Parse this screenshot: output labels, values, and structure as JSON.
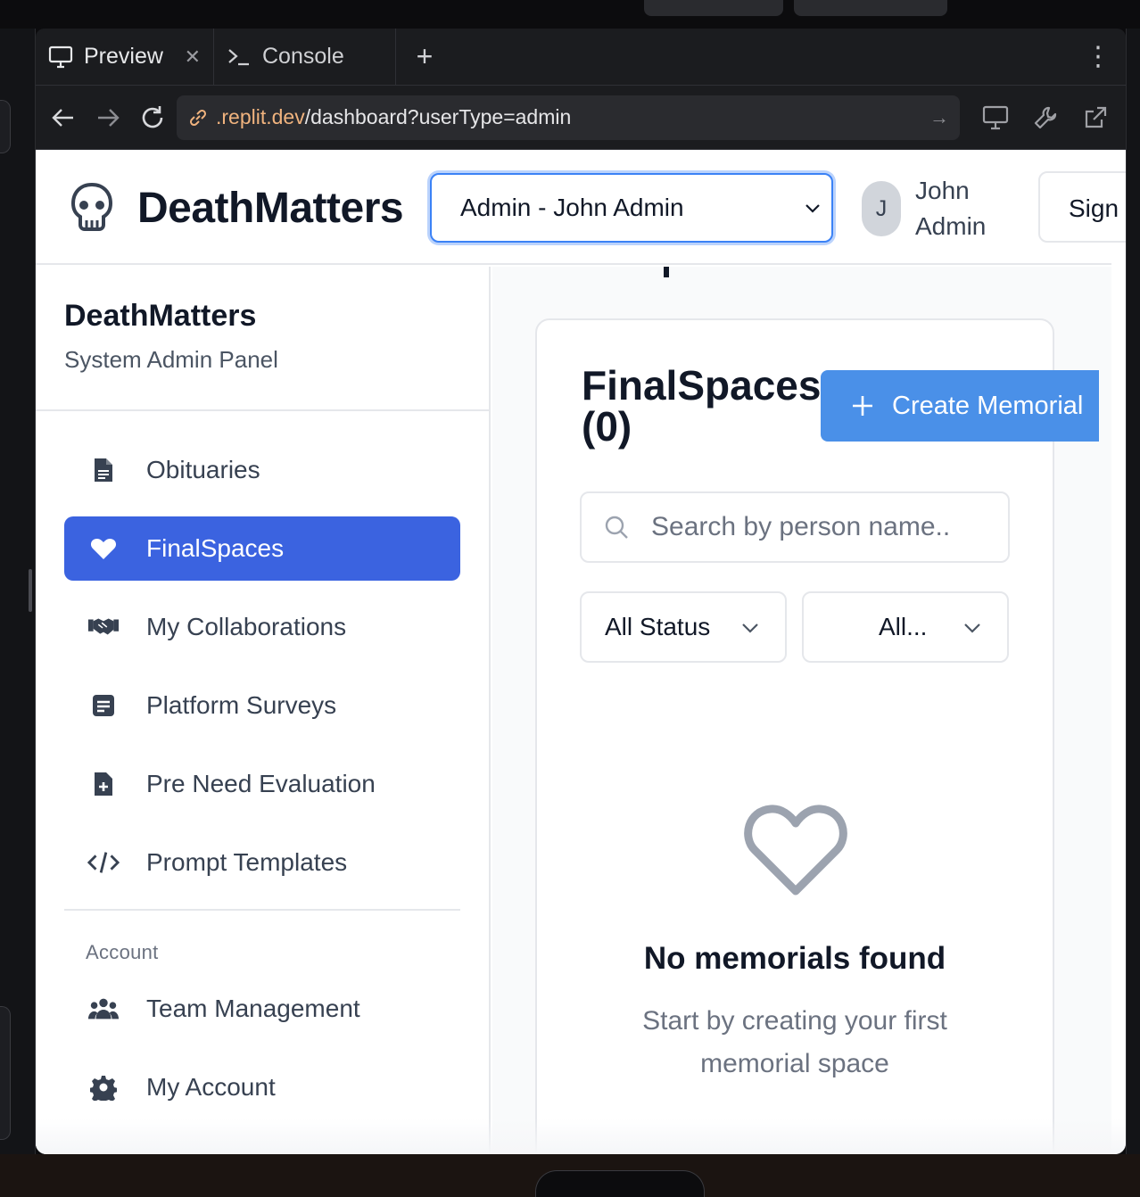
{
  "ide": {
    "tabs": [
      {
        "label": "Preview",
        "icon": "monitor-icon"
      },
      {
        "label": "Console",
        "icon": "terminal-icon"
      }
    ],
    "add_tab": "+",
    "more": "⋮",
    "url": {
      "domain": ".replit.dev",
      "path": "/dashboard?userType=admin"
    }
  },
  "app": {
    "brand": "DeathMatters",
    "role_select": {
      "value": "Admin - John Admin"
    },
    "user": {
      "initial": "J",
      "first": "John",
      "last": "Admin"
    },
    "sign_out_partial": "Sign"
  },
  "sidebar": {
    "title": "DeathMatters",
    "subtitle": "System Admin Panel",
    "items": [
      {
        "label": "Obituaries",
        "icon": "document-icon"
      },
      {
        "label": "FinalSpaces",
        "icon": "heart-icon",
        "active": true
      },
      {
        "label": "My Collaborations",
        "icon": "handshake-icon"
      },
      {
        "label": "Platform Surveys",
        "icon": "survey-icon"
      },
      {
        "label": "Pre Need Evaluation",
        "icon": "file-plus-icon"
      },
      {
        "label": "Prompt Templates",
        "icon": "code-icon"
      }
    ],
    "account_label": "Account",
    "account_items": [
      {
        "label": "Team Management",
        "icon": "users-icon"
      },
      {
        "label": "My Account",
        "icon": "gear-icon"
      }
    ]
  },
  "main": {
    "title_line1": "FinalSpaces",
    "title_line2": "(0)",
    "create_button": "Create Memorial",
    "search_placeholder": "Search by person name..",
    "filters": [
      "All Status",
      "All..."
    ],
    "empty": {
      "title": "No memorials found",
      "subtitle": "Start by creating your first memorial space"
    }
  },
  "colors": {
    "accent": "#3b63e0",
    "button": "#4a90e8",
    "focus_ring": "#3b82f6"
  }
}
